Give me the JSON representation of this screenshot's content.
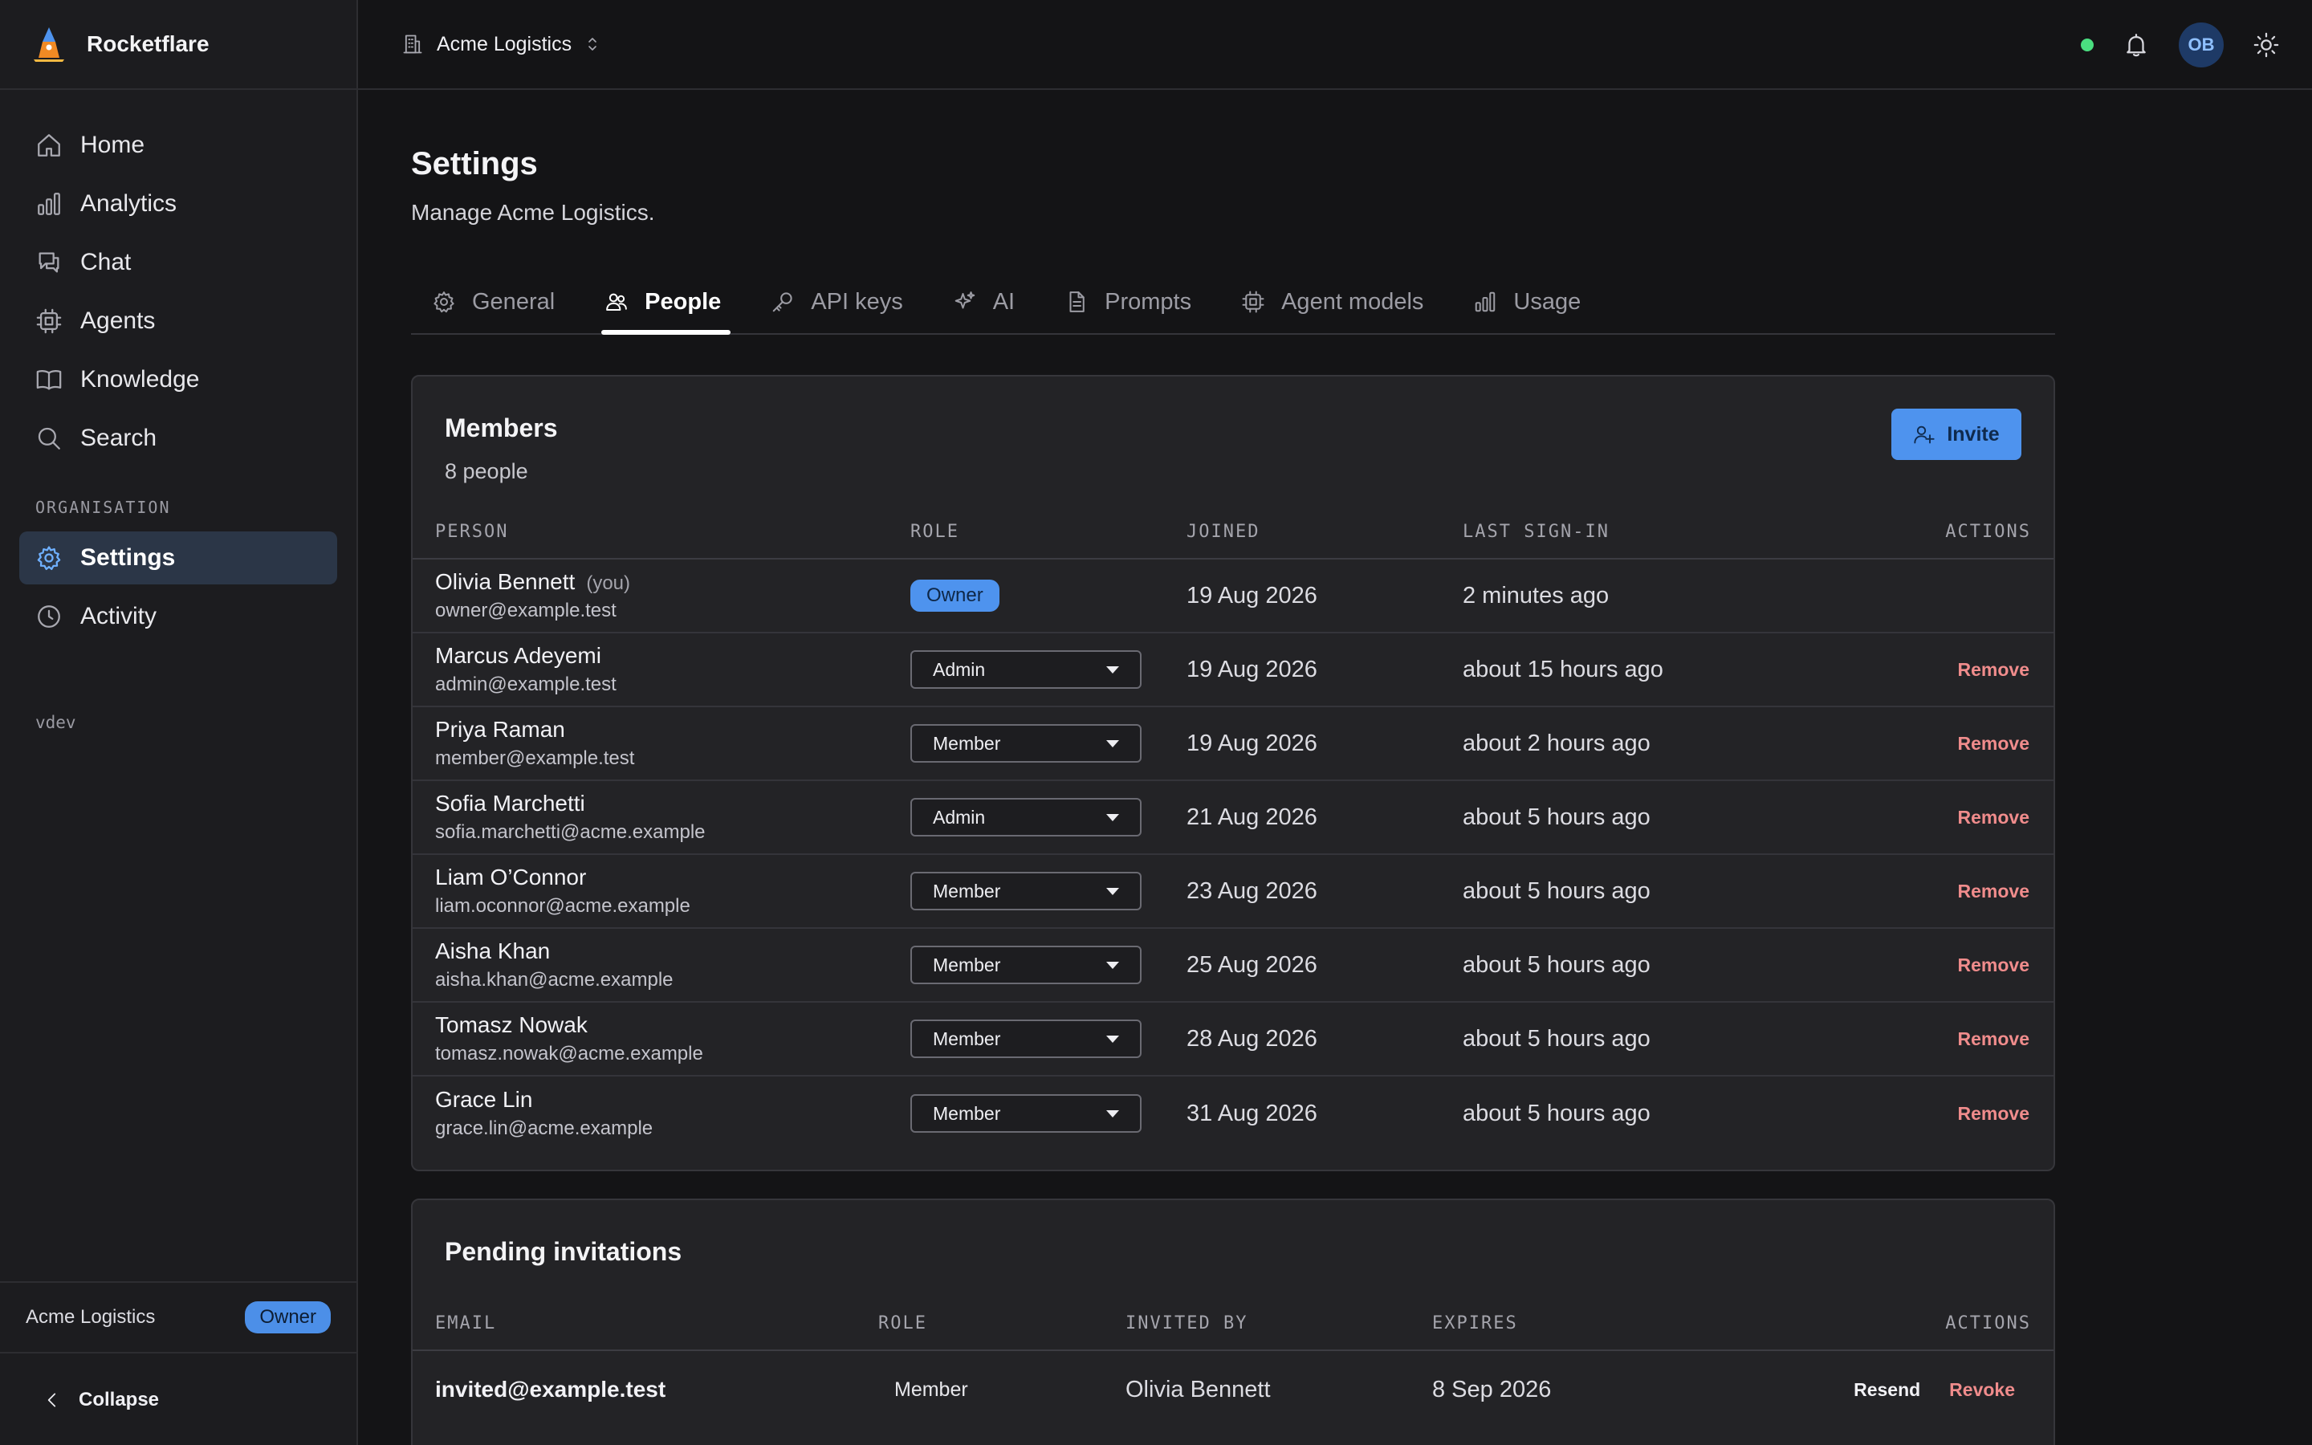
{
  "app": {
    "name": "Rocketflare",
    "accent": "#4e93ee"
  },
  "sidebar": {
    "items": [
      {
        "label": "Home",
        "icon": "home-icon"
      },
      {
        "label": "Analytics",
        "icon": "bar-chart-icon"
      },
      {
        "label": "Chat",
        "icon": "chat-icon"
      },
      {
        "label": "Agents",
        "icon": "cpu-icon"
      },
      {
        "label": "Knowledge",
        "icon": "book-icon"
      },
      {
        "label": "Search",
        "icon": "search-icon"
      }
    ],
    "section_label": "ORGANISATION",
    "org_items": [
      {
        "label": "Settings",
        "icon": "gear-icon",
        "active": true
      },
      {
        "label": "Activity",
        "icon": "clock-icon"
      }
    ],
    "env_label": "vdev",
    "footer": {
      "org_name": "Acme Logistics",
      "role_badge": "Owner"
    },
    "collapse_label": "Collapse"
  },
  "topbar": {
    "org_name": "Acme Logistics",
    "avatar_initials": "OB",
    "status_color": "#4ade80"
  },
  "page": {
    "title": "Settings",
    "subtitle": "Manage Acme Logistics."
  },
  "tabs": [
    {
      "label": "General",
      "icon": "gear-icon"
    },
    {
      "label": "People",
      "icon": "people-icon",
      "active": true
    },
    {
      "label": "API keys",
      "icon": "key-icon"
    },
    {
      "label": "AI",
      "icon": "sparkle-icon"
    },
    {
      "label": "Prompts",
      "icon": "document-icon"
    },
    {
      "label": "Agent models",
      "icon": "cpu-icon"
    },
    {
      "label": "Usage",
      "icon": "bar-chart-icon"
    }
  ],
  "members": {
    "title": "Members",
    "count_label": "8 people",
    "invite_label": "Invite",
    "columns": [
      "PERSON",
      "ROLE",
      "JOINED",
      "LAST SIGN-IN",
      "ACTIONS"
    ],
    "you_label": "(you)",
    "remove_label": "Remove",
    "rows": [
      {
        "name": "Olivia Bennett",
        "email": "owner@example.test",
        "role": "Owner",
        "joined": "19 Aug 2026",
        "last": "2 minutes ago",
        "is_you": true
      },
      {
        "name": "Marcus Adeyemi",
        "email": "admin@example.test",
        "role": "Admin",
        "joined": "19 Aug 2026",
        "last": "about 15 hours ago"
      },
      {
        "name": "Priya Raman",
        "email": "member@example.test",
        "role": "Member",
        "joined": "19 Aug 2026",
        "last": "about 2 hours ago"
      },
      {
        "name": "Sofia Marchetti",
        "email": "sofia.marchetti@acme.example",
        "role": "Admin",
        "joined": "21 Aug 2026",
        "last": "about 5 hours ago"
      },
      {
        "name": "Liam O’Connor",
        "email": "liam.oconnor@acme.example",
        "role": "Member",
        "joined": "23 Aug 2026",
        "last": "about 5 hours ago"
      },
      {
        "name": "Aisha Khan",
        "email": "aisha.khan@acme.example",
        "role": "Member",
        "joined": "25 Aug 2026",
        "last": "about 5 hours ago"
      },
      {
        "name": "Tomasz Nowak",
        "email": "tomasz.nowak@acme.example",
        "role": "Member",
        "joined": "28 Aug 2026",
        "last": "about 5 hours ago"
      },
      {
        "name": "Grace Lin",
        "email": "grace.lin@acme.example",
        "role": "Member",
        "joined": "31 Aug 2026",
        "last": "about 5 hours ago"
      }
    ]
  },
  "invitations": {
    "title": "Pending invitations",
    "columns": [
      "EMAIL",
      "ROLE",
      "INVITED BY",
      "EXPIRES",
      "ACTIONS"
    ],
    "resend_label": "Resend",
    "revoke_label": "Revoke",
    "rows": [
      {
        "email": "invited@example.test",
        "role": "Member",
        "invited_by": "Olivia Bennett",
        "expires": "8 Sep 2026"
      }
    ]
  }
}
